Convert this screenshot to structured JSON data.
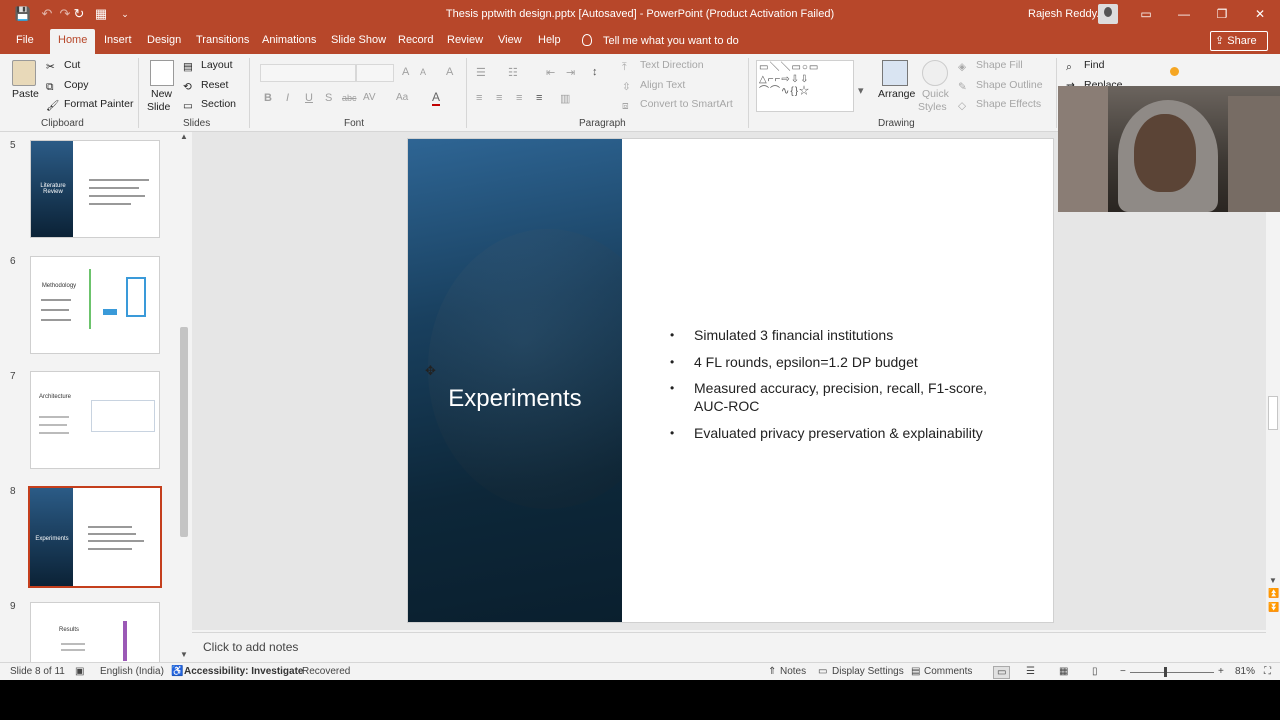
{
  "titlebar": {
    "document_title": "Thesis pptwith design.pptx [Autosaved]  -  PowerPoint (Product Activation Failed)",
    "user_name": "Rajesh Reddy.M",
    "qat": {
      "save": "💾",
      "undo": "↶",
      "redo": "↷",
      "repeat": "↻",
      "present": "▦",
      "more": "⌄"
    },
    "window": {
      "ribbon_display": "▭",
      "minimize": "—",
      "restore": "❐",
      "close": "✕"
    }
  },
  "tabs": {
    "file": "File",
    "home": "Home",
    "insert": "Insert",
    "design": "Design",
    "transitions": "Transitions",
    "animations": "Animations",
    "slideshow": "Slide Show",
    "record": "Record",
    "review": "Review",
    "view": "View",
    "help": "Help",
    "tellme": "Tell me what you want to do",
    "share": "Share"
  },
  "ribbon": {
    "clipboard": {
      "paste": "Paste",
      "cut": "Cut",
      "copy": "Copy",
      "format_painter": "Format Painter",
      "group": "Clipboard"
    },
    "slides": {
      "new_slide_1": "New",
      "new_slide_2": "Slide",
      "layout": "Layout",
      "reset": "Reset",
      "section": "Section",
      "group": "Slides"
    },
    "font": {
      "bold": "B",
      "italic": "I",
      "underline": "U",
      "shadow": "S",
      "strike": "abc",
      "spacing": "AV",
      "case": "Aa",
      "color": "A",
      "grow": "A",
      "shrink": "A",
      "clear": "A",
      "group": "Font"
    },
    "paragraph": {
      "text_direction": "Text Direction",
      "align_text": "Align Text",
      "convert_smartart": "Convert to SmartArt",
      "group": "Paragraph"
    },
    "drawing": {
      "arrange": "Arrange",
      "quick_styles_1": "Quick",
      "quick_styles_2": "Styles",
      "shape_fill": "Shape Fill",
      "shape_outline": "Shape Outline",
      "shape_effects": "Shape Effects",
      "group": "Drawing"
    },
    "editing": {
      "find": "Find",
      "replace": "Replace"
    }
  },
  "thumbnails": [
    {
      "number": "5",
      "title": "Literature Review",
      "style": "dark"
    },
    {
      "number": "6",
      "title": "Methodology",
      "style": "light"
    },
    {
      "number": "7",
      "title": "Architecture",
      "style": "light"
    },
    {
      "number": "8",
      "title": "Experiments",
      "style": "dark",
      "selected": true
    },
    {
      "number": "9",
      "title": "Results",
      "style": "light"
    }
  ],
  "slide": {
    "title": "Experiments",
    "bullets": [
      "Simulated 3 financial institutions",
      "4 FL rounds, epsilon=1.2 DP budget",
      "Measured accuracy, precision, recall, F1-score, AUC-ROC",
      "Evaluated privacy preservation & explainability"
    ],
    "colors": {
      "panel_top": "#2e6594",
      "panel_bottom": "#0a1f2e",
      "accent": "#b7472a"
    }
  },
  "notes": {
    "placeholder": "Click to add notes"
  },
  "statusbar": {
    "slide_of": "Slide 8 of 11",
    "language": "English (India)",
    "accessibility": "Accessibility: Investigate",
    "recovered": "Recovered",
    "notes": "Notes",
    "display_settings": "Display Settings",
    "comments": "Comments",
    "zoom": "81%",
    "zoom_minus": "−",
    "zoom_plus": "+"
  }
}
